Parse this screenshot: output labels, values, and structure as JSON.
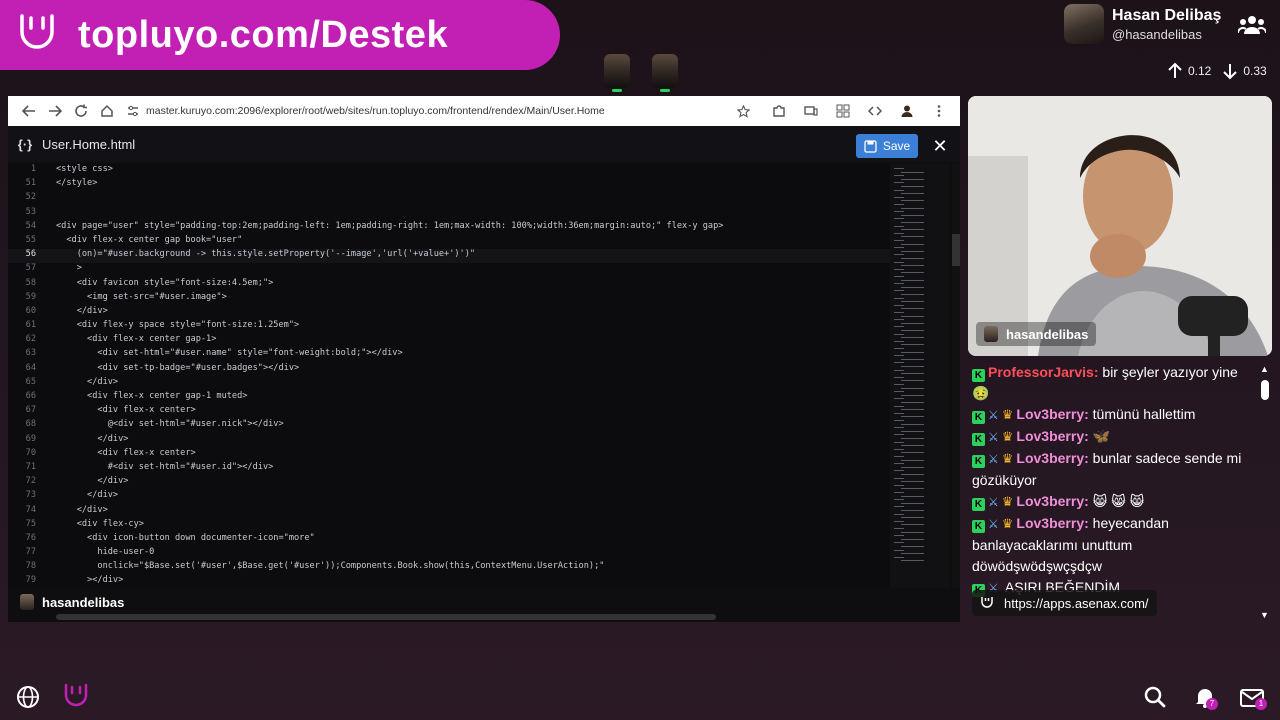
{
  "banner": {
    "text": "topluyo.com/Destek"
  },
  "profile": {
    "name": "Hasan Delibaş",
    "handle": "@hasandelibas"
  },
  "network": {
    "up": "0.12",
    "down": "0.33"
  },
  "browser": {
    "url": "master.kuruyo.com:2096/explorer/root/web/sites/run.topluyo.com/frontend/rendex/Main/User.Home"
  },
  "editor": {
    "file_name": "User.Home.html",
    "save_label": "Save",
    "status_user": "hasandelibas",
    "lines": [
      {
        "n": "1",
        "code": "<style css>"
      },
      {
        "n": "51",
        "code": "</style>"
      },
      {
        "n": "52",
        "code": ""
      },
      {
        "n": "53",
        "code": ""
      },
      {
        "n": "54",
        "code": "<div page=\"user\" style=\"padding-top:2em;padding-left: 1em;padding-right: 1em;max-width: 100%;width:36em;margin:auto;\" flex-y gap>"
      },
      {
        "n": "55",
        "code": "  <div flex-x center gap book=\"user\""
      },
      {
        "n": "56",
        "code": "    (on)=\"#user.background -> this.style.setProperty('--image','url('+value+')')\""
      },
      {
        "n": "57",
        "code": "    >"
      },
      {
        "n": "58",
        "code": "    <div favicon style=\"font-size:4.5em;\">"
      },
      {
        "n": "59",
        "code": "      <img set-src=\"#user.image\">"
      },
      {
        "n": "60",
        "code": "    </div>"
      },
      {
        "n": "61",
        "code": "    <div flex-y space style=\"font-size:1.25em\">"
      },
      {
        "n": "62",
        "code": "      <div flex-x center gap-1>"
      },
      {
        "n": "63",
        "code": "        <div set-html=\"#user.name\" style=\"font-weight:bold;\"></div>"
      },
      {
        "n": "64",
        "code": "        <div set-tp-badge=\"#user.badges\"></div>"
      },
      {
        "n": "65",
        "code": "      </div>"
      },
      {
        "n": "66",
        "code": "      <div flex-x center gap-1 muted>"
      },
      {
        "n": "67",
        "code": "        <div flex-x center>"
      },
      {
        "n": "68",
        "code": "          @<div set-html=\"#user.nick\"></div>"
      },
      {
        "n": "69",
        "code": "        </div>"
      },
      {
        "n": "70",
        "code": "        <div flex-x center>"
      },
      {
        "n": "71",
        "code": "          #<div set-html=\"#user.id\"></div>"
      },
      {
        "n": "72",
        "code": "        </div>"
      },
      {
        "n": "73",
        "code": "      </div>"
      },
      {
        "n": "74",
        "code": "    </div>"
      },
      {
        "n": "75",
        "code": "    <div flex-cy>"
      },
      {
        "n": "76",
        "code": "      <div icon-button down documenter-icon=\"more\""
      },
      {
        "n": "77",
        "code": "        hide-user-0"
      },
      {
        "n": "78",
        "code": "        onclick=\"$Base.set('#user',$Base.get('#user'));Components.Book.show(this,ContextMenu.UserAction);\""
      },
      {
        "n": "79",
        "code": "      ></div>"
      }
    ]
  },
  "webcam": {
    "label": "hasandelibas"
  },
  "chat": {
    "messages": [
      {
        "user": "ProfessorJarvis:",
        "color": "#ff4d5a",
        "badges": [
          "k"
        ],
        "text": "bir şeyler yazıyor yine",
        "emoji": "🤢"
      },
      {
        "user": "Lov3berry:",
        "color": "#f08fd8",
        "badges": [
          "k",
          "sword",
          "crown"
        ],
        "text": "tümünü hallettim",
        "emoji": ""
      },
      {
        "user": "Lov3berry:",
        "color": "#f08fd8",
        "badges": [
          "k",
          "sword",
          "crown"
        ],
        "text": "",
        "emoji": "🦋"
      },
      {
        "user": "Lov3berry:",
        "color": "#f08fd8",
        "badges": [
          "k",
          "sword",
          "crown"
        ],
        "text": "bunlar sadece sende mi gözüküyor",
        "emoji": ""
      },
      {
        "user": "Lov3berry:",
        "color": "#f08fd8",
        "badges": [
          "k",
          "sword",
          "crown"
        ],
        "text": "",
        "emoji": "😸 😸 😸"
      },
      {
        "user": "Lov3berry:",
        "color": "#f08fd8",
        "badges": [
          "k",
          "sword",
          "crown"
        ],
        "text": "heyecandan banlayacaklarımı unuttum döwödşwödşwçşdçw",
        "emoji": ""
      },
      {
        "user": "",
        "color": "#f08fd8",
        "badges": [
          "k",
          "sword"
        ],
        "text": "AŞIRI BEĞENDİM",
        "emoji": ""
      }
    ],
    "link_toast": "https://apps.asenax.com/"
  },
  "bottom": {
    "bell_count": "7",
    "mail_count": "1"
  }
}
